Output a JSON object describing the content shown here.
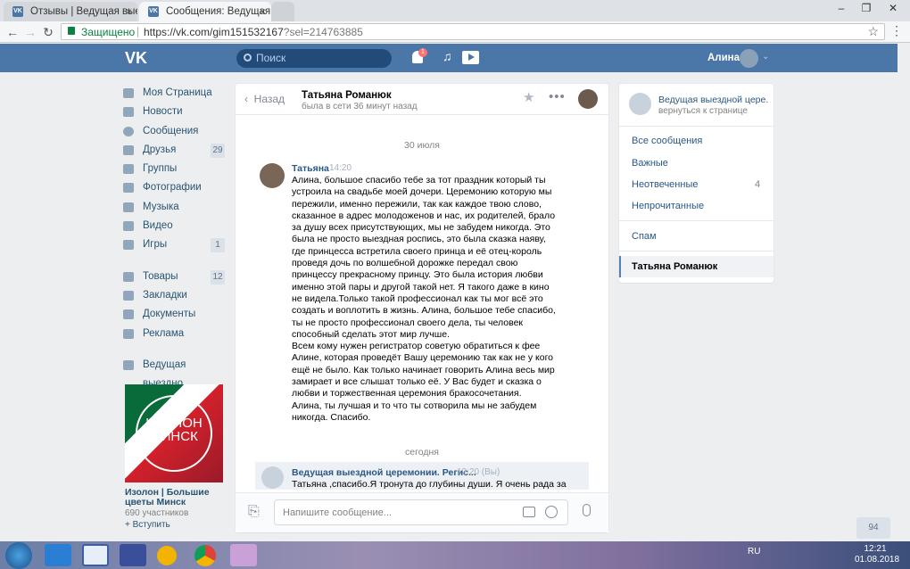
{
  "browser": {
    "tabs": [
      {
        "title": "Отзывы | Ведущая выезд",
        "favicon": "VK"
      },
      {
        "title": "Сообщения: Ведущая вы",
        "favicon": "VK"
      }
    ],
    "secure_label": "Защищено",
    "url_base": "https://vk.com/gim151532167",
    "url_query": "?sel=214763885"
  },
  "header": {
    "logo": "VK",
    "search_placeholder": "Поиск",
    "notifications_count": "1",
    "user_name": "Алина"
  },
  "sidebar": {
    "items": [
      {
        "label": "Моя Страница",
        "icon": "home-icon"
      },
      {
        "label": "Новости",
        "icon": "news-icon"
      },
      {
        "label": "Сообщения",
        "icon": "messages-icon"
      },
      {
        "label": "Друзья",
        "icon": "friends-icon",
        "count": "29"
      },
      {
        "label": "Группы",
        "icon": "groups-icon"
      },
      {
        "label": "Фотографии",
        "icon": "photos-icon"
      },
      {
        "label": "Музыка",
        "icon": "music-icon"
      },
      {
        "label": "Видео",
        "icon": "video-icon"
      },
      {
        "label": "Игры",
        "icon": "games-icon",
        "count": "1"
      }
    ],
    "items2": [
      {
        "label": "Товары",
        "icon": "goods-icon",
        "count": "12"
      },
      {
        "label": "Закладки",
        "icon": "bookmarks-icon"
      },
      {
        "label": "Документы",
        "icon": "documents-icon"
      },
      {
        "label": "Реклама",
        "icon": "ads-icon"
      }
    ],
    "community": "Ведущая выездно...",
    "group": {
      "image_text_1": "ИЗОЛОН",
      "image_text_2": "МИНСК",
      "title": "Изолон | Большие цветы Минск",
      "members": "690 участников",
      "join": "+ Вступить"
    }
  },
  "dialog": {
    "back_label": "Назад",
    "peer_name": "Татьяна Романюк",
    "peer_status": "была в сети 36 минут назад",
    "date1": "30 июля",
    "msg1": {
      "author": "Татьяна",
      "time": "14:20",
      "text": "Алина, большое спасибо тебе за тот праздник который ты устроила на свадьбе моей дочери. Церемонию которую мы пережили, именно пережили, так как каждое твою слово, сказанное в адрес молодоженов и нас, их родителей, брало за душу всех присутствующих, мы не забудем никогда. Это была не просто выездная роспись, это была сказка наяву, где принцесса встретила своего принца и её отец-король проведя дочь по волшебной дорожке передал свою принцессу прекрасному принцу. Это была история любви именно этой пары и другой такой нет. Я такого даже в кино не видела.Только такой профессионал как ты мог всё это создать и воплотить в жизнь. Алина, большое тебе спасибо, ты не просто профессионал своего дела, ты человек способный сделать этот мир лучше.\nВсем кому нужен регистратор советую обратиться к фее Алине, которая проведёт Вашу церемонию так как не у кого ещё не было. Как только начинает говорить Алина весь мир замирает и все слышат только её. У Вас будет и сказка о любви и торжественная церемония бракосочетания.\nАлина, ты лучшая и то что ты сотворила мы не забудем никогда. Спасибо."
    },
    "date2": "сегодня",
    "msg2": {
      "author": "Ведущая выездной церемонии. Регис...",
      "time": "12:20 (Вы)",
      "text": "Татьяна ,спасибо.Я тронута до глубины души. Я очень рада за"
    },
    "compose_placeholder": "Напишите сообщение..."
  },
  "right_panel": {
    "community_title": "Ведущая выездной цере...",
    "community_sub": "вернуться к странице",
    "filters": [
      {
        "label": "Все сообщения"
      },
      {
        "label": "Важные"
      },
      {
        "label": "Неотвеченные",
        "count": "4"
      },
      {
        "label": "Непрочитанные"
      }
    ],
    "spam": "Спам",
    "active_chat": "Татьяна Романюк"
  },
  "float_badge": "94",
  "taskbar": {
    "lang": "RU",
    "time": "12:21",
    "date": "01.08.2018"
  }
}
